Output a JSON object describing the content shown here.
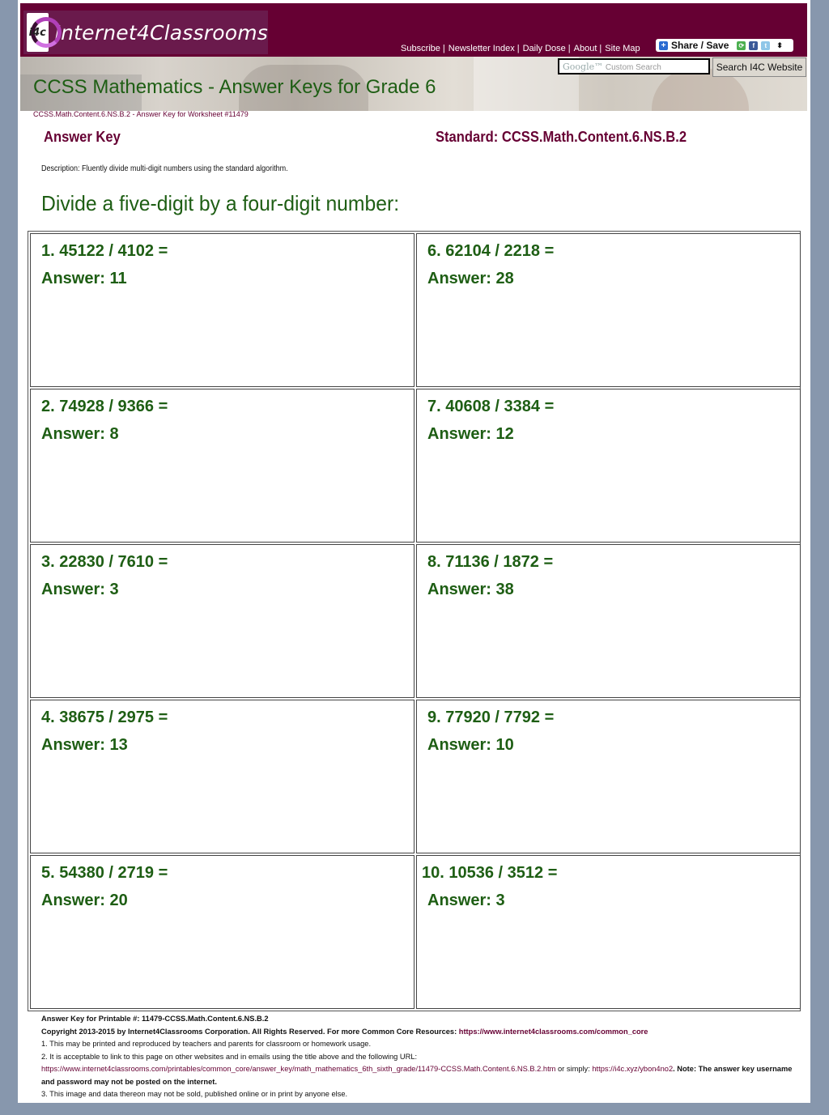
{
  "header": {
    "logo_small": "i4c",
    "site_name": "Internet4Classrooms",
    "nav": [
      "Subscribe",
      "Newsletter Index",
      "Daily Dose",
      "About",
      "Site Map"
    ],
    "share_label": "Share / Save",
    "search_placeholder": "Custom Search",
    "search_brand": "Google™",
    "search_button": "Search I4C Website"
  },
  "page": {
    "title": "CCSS Mathematics - Answer Keys for Grade 6",
    "breadcrumb": "CCSS.Math.Content.6.NS.B.2 - Answer Key for Worksheet #11479",
    "answer_key_label": "Answer Key",
    "standard_label": "Standard: CCSS.Math.Content.6.NS.B.2",
    "description": "Description: Fluently divide multi-digit numbers using the standard algorithm.",
    "heading": "Divide a five-digit by a four-digit number:"
  },
  "problems": [
    {
      "question": "1. 45122 / 4102 =",
      "answer": "Answer: 11"
    },
    {
      "question": "6. 62104 / 2218 =",
      "answer": "Answer: 28"
    },
    {
      "question": "2. 74928 / 9366 =",
      "answer": "Answer: 8"
    },
    {
      "question": "7. 40608 / 3384 =",
      "answer": "Answer: 12"
    },
    {
      "question": "3. 22830 / 7610 =",
      "answer": "Answer: 3"
    },
    {
      "question": "8. 71136 / 1872 =",
      "answer": "Answer: 38"
    },
    {
      "question": "4. 38675 / 2975 =",
      "answer": "Answer: 13"
    },
    {
      "question": "9. 77920 / 7792 =",
      "answer": "Answer: 10"
    },
    {
      "question": "5. 54380 / 2719 =",
      "answer": "Answer: 20"
    },
    {
      "question": "10. 10536 / 3512 =",
      "answer": "Answer: 3"
    }
  ],
  "footer": {
    "printable": "Answer Key for Printable #: 11479-CCSS.Math.Content.6.NS.B.2",
    "copyright": "Copyright 2013-2015 by Internet4Classrooms Corporation. All Rights Reserved. For more Common Core Resources:",
    "common_core_link": "https://www.internet4classrooms.com/common_core",
    "note1": "1. This may be printed and reproduced by teachers and parents for classroom or homework usage.",
    "note2": "2. It is acceptable to link to this page on other websites and in emails using the title above and the following URL:",
    "long_url": "https://www.internet4classrooms.com/printables/common_core/answer_key/math_mathematics_6th_sixth_grade/11479-CCSS.Math.Content.6.NS.B.2.htm",
    "or_simply": " or simply: ",
    "short_url": "https://i4c.xyz/ybon4no2",
    "note_tail": ". Note: The answer key username and password may not be posted on the internet.",
    "note3": "3. This image and data thereon may not be sold, published online or in print by anyone else."
  }
}
